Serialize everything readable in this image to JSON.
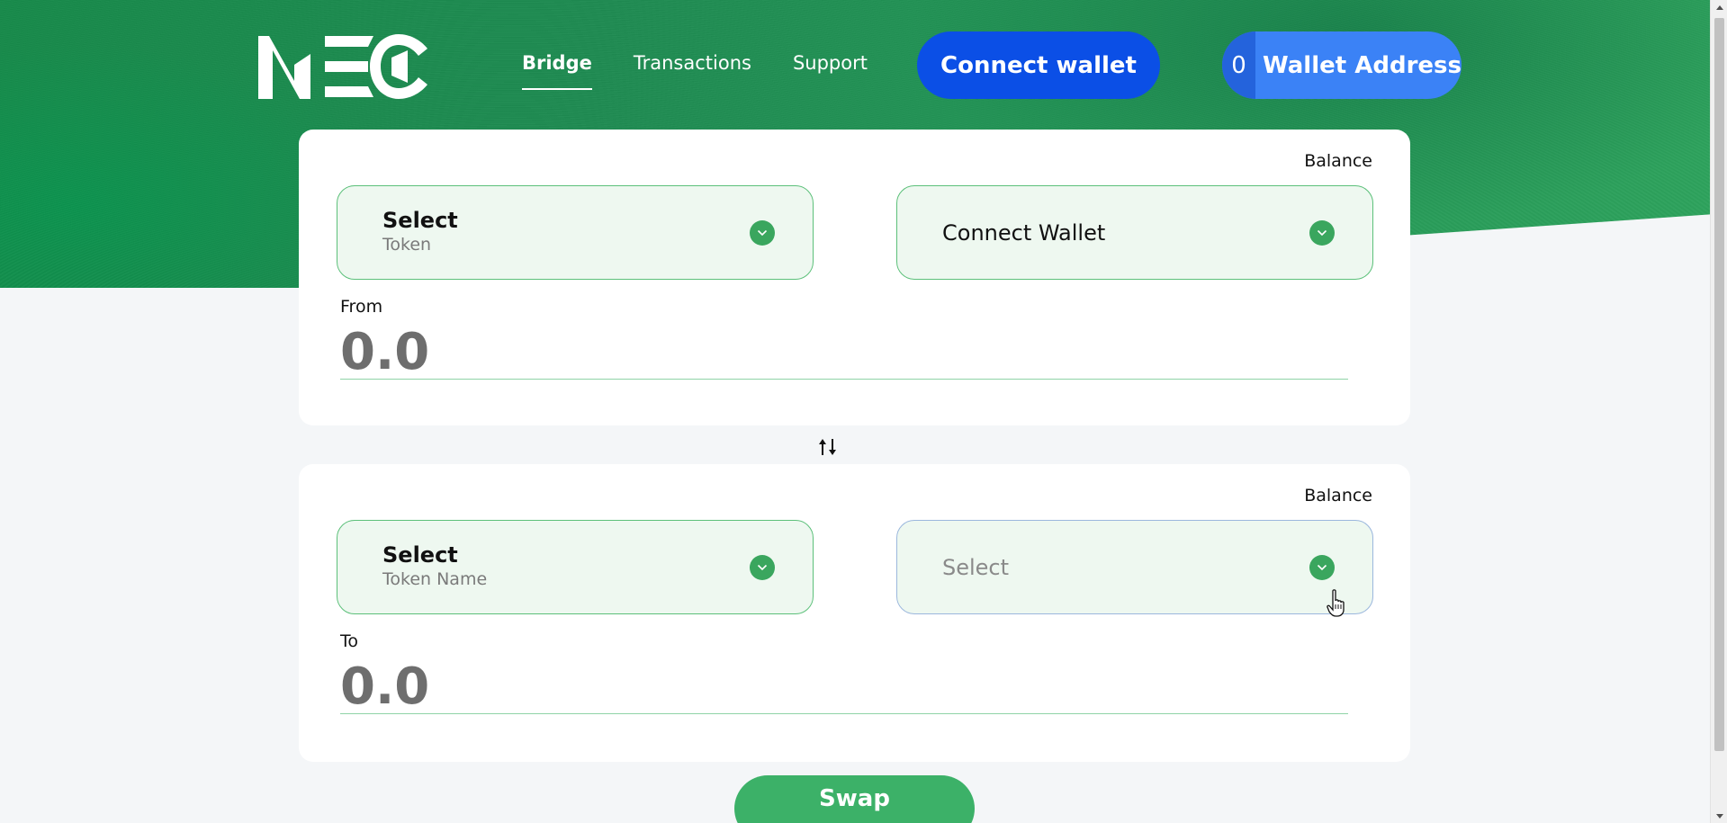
{
  "header": {
    "logo_text": "NEC",
    "nav": [
      {
        "label": "Bridge",
        "active": true
      },
      {
        "label": "Transactions",
        "active": false
      },
      {
        "label": "Support",
        "active": false
      }
    ],
    "connect_button": "Connect wallet",
    "wallet": {
      "count": "0",
      "address_label": "Wallet Address"
    }
  },
  "from_card": {
    "balance_label": "Balance",
    "token_select": {
      "title": "Select",
      "subtitle": "Token"
    },
    "wallet_select": {
      "label": "Connect Wallet"
    },
    "direction_label": "From",
    "amount_placeholder": "0.0"
  },
  "to_card": {
    "balance_label": "Balance",
    "token_select": {
      "title": "Select",
      "subtitle": "Token Name"
    },
    "network_select": {
      "placeholder": "Select"
    },
    "direction_label": "To",
    "amount_placeholder": "0.0"
  },
  "swap_button": "Swap",
  "icons": {
    "chevron": "chevron-down-icon",
    "swap_direction": "swap-arrows-icon",
    "cursor": "hand-pointer-icon"
  },
  "colors": {
    "brand_green": "#3cb168",
    "hero_green": "#1f8b52",
    "primary_blue": "#0b4fe6",
    "wallet_blue": "#3b82f6",
    "select_bg": "#eef8f0"
  }
}
